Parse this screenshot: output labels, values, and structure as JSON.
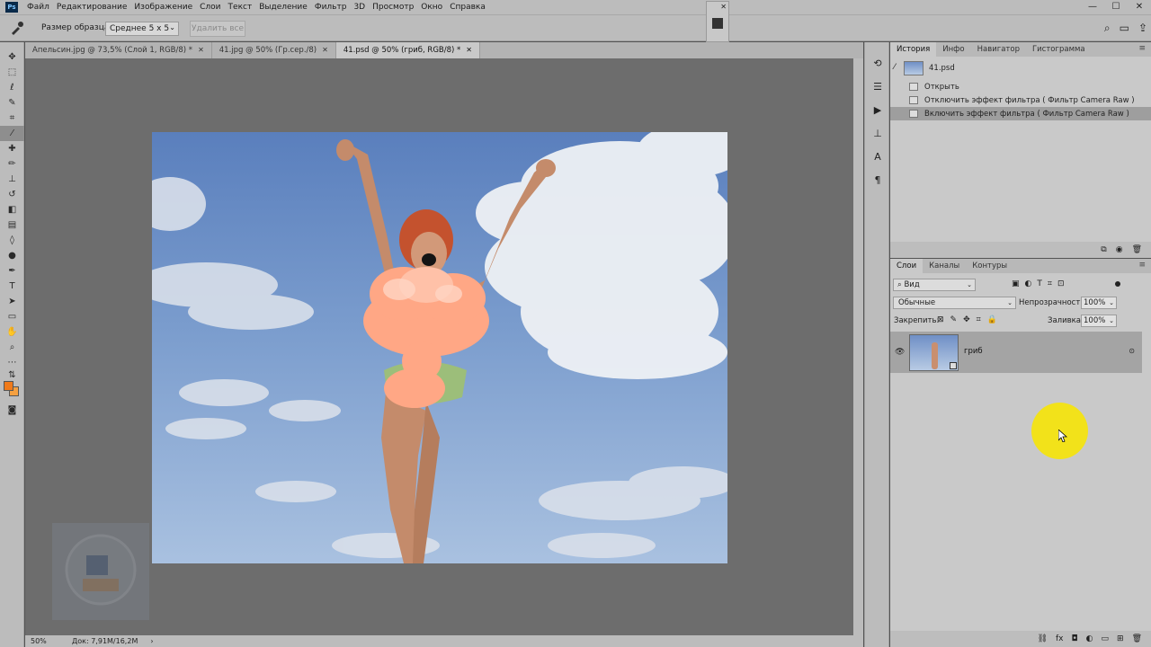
{
  "app": {
    "logo": "Ps"
  },
  "menu": [
    "Файл",
    "Редактирование",
    "Изображение",
    "Слои",
    "Текст",
    "Выделение",
    "Фильтр",
    "3D",
    "Просмотр",
    "Окно",
    "Справка"
  ],
  "window_controls": {
    "minimize": "—",
    "maximize": "☐",
    "close": "✕"
  },
  "options_bar": {
    "sample_size_label": "Размер образца:",
    "sample_size_value": "Среднее 5 x 5",
    "clear_all_label": "Удалить все"
  },
  "doc_tabs": [
    {
      "label": "Апельсин.jpg @ 73,5% (Слой 1, RGB/8) *",
      "active": false
    },
    {
      "label": "41.jpg @ 50% (Гр.сер./8)",
      "active": false
    },
    {
      "label": "41.psd @ 50% (гриб, RGB/8) *",
      "active": true
    }
  ],
  "status": {
    "zoom": "50%",
    "doc": "Док: 7,91M/16,2M"
  },
  "history_panel": {
    "tabs": [
      "История",
      "Инфо",
      "Навигатор",
      "Гистограмма"
    ],
    "snapshot": "41.psd",
    "items": [
      {
        "label": "Открыть",
        "active": false
      },
      {
        "label": "Отключить эффект фильтра ( Фильтр Camera Raw )",
        "active": false
      },
      {
        "label": "Включить эффект фильтра ( Фильтр Camera Raw )",
        "active": true
      }
    ]
  },
  "layers_panel": {
    "tabs": [
      "Слои",
      "Каналы",
      "Контуры"
    ],
    "kind_filter": "Вид",
    "blend_mode": "Обычные",
    "opacity_label": "Непрозрачность:",
    "opacity_value": "100%",
    "lock_label": "Закрепить:",
    "fill_label": "Заливка:",
    "fill_value": "100%",
    "layers": [
      {
        "name": "гриб",
        "visible": true,
        "smart_object": true
      }
    ]
  },
  "colors": {
    "foreground": "#f07a1a",
    "background": "#f5a040",
    "cursor_highlight": "#f2e21a"
  }
}
